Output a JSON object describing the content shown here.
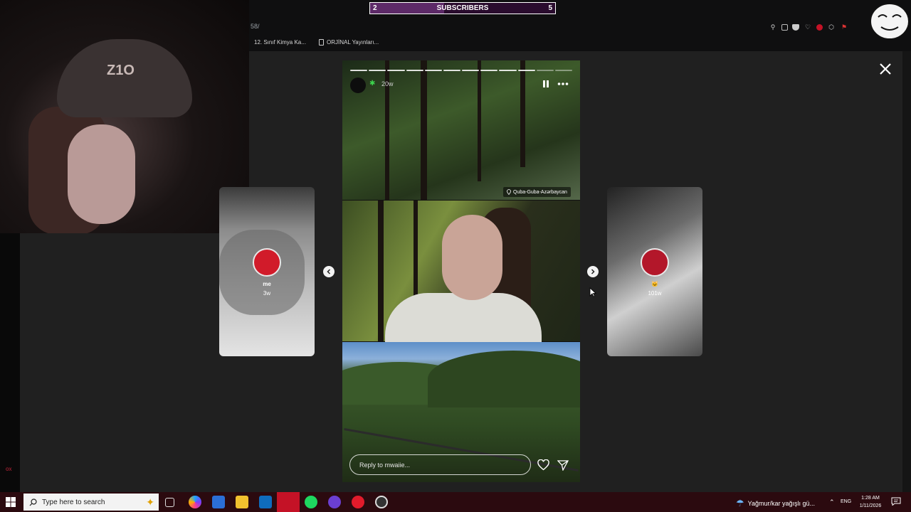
{
  "browser": {
    "url_fragment": "58/",
    "bookmarks": [
      "12. Sınıf Kimya Ka...",
      "ORJİNAL Yayınları..."
    ]
  },
  "subscribers": {
    "current": "2",
    "title": "SUBSCRIBERS",
    "goal": "5",
    "progress": 0.4
  },
  "webcam": {
    "hat_text": "Z1O",
    "corner_text": "ox"
  },
  "story": {
    "time": "20w",
    "location": "Quba-Guba-Azərbaycan",
    "reply_placeholder": "Reply to mwaiie...",
    "segments_total": 12,
    "segments_done": 10
  },
  "previews": {
    "left": {
      "name": "me",
      "time": "3w"
    },
    "right": {
      "name": "",
      "emoji": "🐱",
      "time": "101w"
    }
  },
  "taskbar": {
    "search_placeholder": "Type here to search",
    "weather": "Yağmur/kar yağışlı gü...",
    "language": "ENG",
    "time": "1:28 AM",
    "date": "1/11/2026"
  },
  "colors": {
    "accent_red": "#c41226",
    "subscriber_bar": "#5d2a68",
    "taskbar": "#2b0a0f"
  }
}
